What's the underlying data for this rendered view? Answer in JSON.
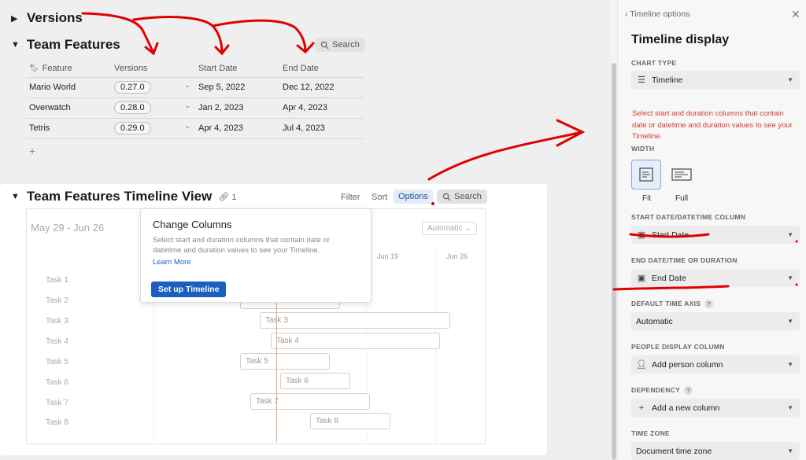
{
  "main": {
    "versions_title": "Versions",
    "features_title": "Team Features",
    "search_label": "Search",
    "table": {
      "headers": [
        "Feature",
        "Versions",
        "Start Date",
        "End Date"
      ],
      "rows": [
        {
          "feature": "Mario World",
          "version": "0.27.0",
          "start": "Sep 5, 2022",
          "end": "Dec 12, 2022"
        },
        {
          "feature": "Overwatch",
          "version": "0.28.0",
          "start": "Jan 2, 2023",
          "end": "Apr 4, 2023"
        },
        {
          "feature": "Tetris",
          "version": "0.29.0",
          "start": "Apr 4, 2023",
          "end": "Jul 4, 2023"
        }
      ],
      "add_row": "+"
    },
    "timeline": {
      "title": "Team Features Timeline View",
      "link_count": "1",
      "toolbar": {
        "filter": "Filter",
        "sort": "Sort",
        "options": "Options",
        "search": "Search"
      },
      "date_range": "May 29 - Jun 26",
      "zoom_select": "Automatic",
      "weeks": [
        "Jun 19",
        "Jun 26"
      ],
      "tasks": [
        "Task 1",
        "Task 2",
        "Task 3",
        "Task 4",
        "Task 5",
        "Task 6",
        "Task 7",
        "Task 8"
      ],
      "bars": [
        "Task 3",
        "Task 4",
        "Task 5",
        "Task 6",
        "Task 7",
        "Task 8"
      ]
    },
    "popover": {
      "title": "Change Columns",
      "description": "Select start and duration columns that contain date or datetime and duration values to see your Timeline.",
      "learn_more": "Learn More",
      "button": "Set up Timeline"
    }
  },
  "panel": {
    "back_label": "Timeline options",
    "title": "Timeline display",
    "chart_type_label": "CHART TYPE",
    "chart_type_value": "Timeline",
    "warning": "Select start and duration columns that contain date or datetime and duration values to see your Timeline.",
    "width_label": "WIDTH",
    "width_fit": "Fit",
    "width_full": "Full",
    "start_label": "START DATE/DATETIME COLUMN",
    "start_value": "Start Date",
    "end_label": "END DATE/TIME OR DURATION",
    "end_value": "End Date",
    "time_axis_label": "DEFAULT TIME AXIS",
    "time_axis_value": "Automatic",
    "people_label": "PEOPLE DISPLAY COLUMN",
    "people_value": "Add person column",
    "dependency_label": "DEPENDENCY",
    "dependency_value": "Add a new column",
    "timezone_label": "TIME ZONE",
    "timezone_value": "Document time zone",
    "help_mark": "?"
  },
  "colors": {
    "accent": "#1b5fc1",
    "warning": "#d23c2f",
    "annotation": "#e00000"
  }
}
